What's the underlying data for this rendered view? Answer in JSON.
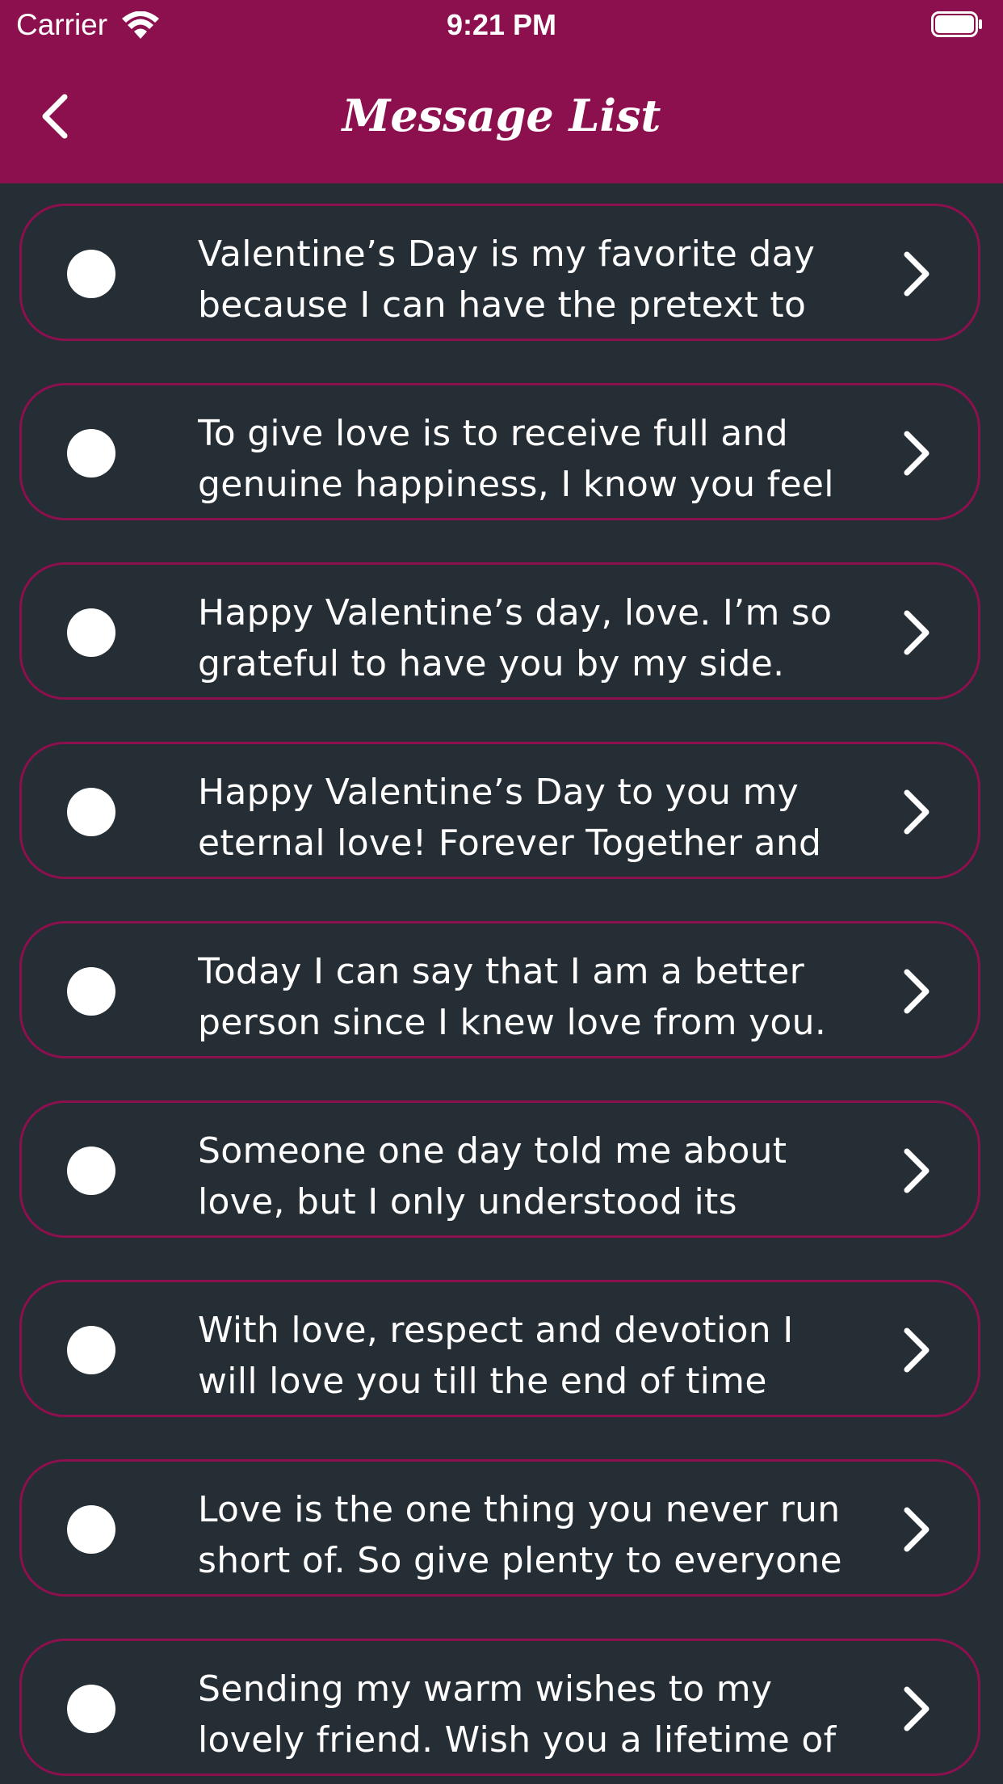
{
  "status_bar": {
    "carrier": "Carrier",
    "time": "9:21 PM"
  },
  "nav_bar": {
    "title": "Message List",
    "back_icon": "chevron-left-icon"
  },
  "colors": {
    "header": "#8c0f4e",
    "background": "#252d35",
    "card_border": "#8c0f4e",
    "text": "#ffffff"
  },
  "messages": [
    {
      "line1": "Valentine’s Day is my favorite day",
      "line2": "because I can have the pretext to"
    },
    {
      "line1": "To give love is to receive full and",
      "line2": "genuine happiness, I know you feel"
    },
    {
      "line1": "Happy Valentine’s day, love. I’m so",
      "line2": "grateful to have you by my side."
    },
    {
      "line1": "Happy Valentine’s Day to you my",
      "line2": "eternal love! Forever Together and"
    },
    {
      "line1": "Today I can say that I am a better",
      "line2": "person since I knew love from you."
    },
    {
      "line1": "Someone one day told me about",
      "line2": "love, but I only understood its"
    },
    {
      "line1": "With love, respect and devotion I",
      "line2": "will love you till the end of time"
    },
    {
      "line1": "Love is the one thing you never run",
      "line2": "short of. So give plenty to everyone"
    },
    {
      "line1": "Sending my warm wishes to my",
      "line2": "lovely friend. Wish you a lifetime of"
    }
  ]
}
